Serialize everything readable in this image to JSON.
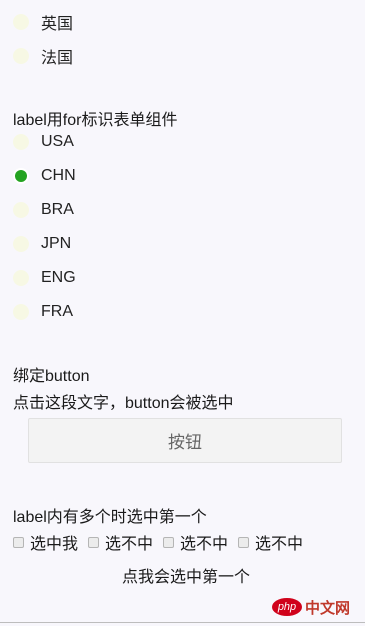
{
  "group1": {
    "options": [
      {
        "label": "英国",
        "checked": false
      },
      {
        "label": "法国",
        "checked": false
      }
    ]
  },
  "group2": {
    "heading": "label用for标识表单组件",
    "options": [
      {
        "label": "USA",
        "checked": false
      },
      {
        "label": "CHN",
        "checked": true
      },
      {
        "label": "BRA",
        "checked": false
      },
      {
        "label": "JPN",
        "checked": false
      },
      {
        "label": "ENG",
        "checked": false
      },
      {
        "label": "FRA",
        "checked": false
      }
    ]
  },
  "bind_section": {
    "heading": "绑定button",
    "description": "点击这段文字，button会被选中",
    "button_label": "按钮"
  },
  "multi_section": {
    "heading": "label内有多个时选中第一个",
    "checkboxes": [
      {
        "label": "选中我"
      },
      {
        "label": "选不中"
      },
      {
        "label": "选不中"
      },
      {
        "label": "选不中"
      }
    ],
    "footer_text": "点我会选中第一个"
  },
  "watermark": {
    "badge": "php",
    "text": "中文网"
  },
  "colors": {
    "accent": "#24a321",
    "radio_bg": "#f7f8e4",
    "page_bg": "#f8f7fc"
  }
}
